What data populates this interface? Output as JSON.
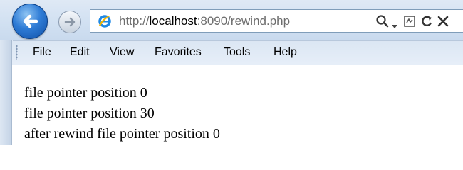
{
  "browser": {
    "address_bar": {
      "url_prefix": "http://",
      "url_host": "localhost",
      "url_rest": ":8090/rewind.php"
    },
    "icons": {
      "back": "back-arrow-icon",
      "forward": "forward-arrow-icon",
      "page": "ie-logo-icon",
      "search": "search-icon",
      "compat": "compatibility-view-icon",
      "refresh": "refresh-icon",
      "stop": "stop-icon"
    },
    "menu": [
      "File",
      "Edit",
      "View",
      "Favorites",
      "Tools",
      "Help"
    ]
  },
  "page": {
    "lines": [
      "file pointer position 0",
      "file pointer position 30",
      "after rewind file pointer position 0"
    ]
  },
  "colors": {
    "back_button": "#2f7cd6",
    "ie_logo": "#1e88e5",
    "frame": "#c9daee"
  }
}
